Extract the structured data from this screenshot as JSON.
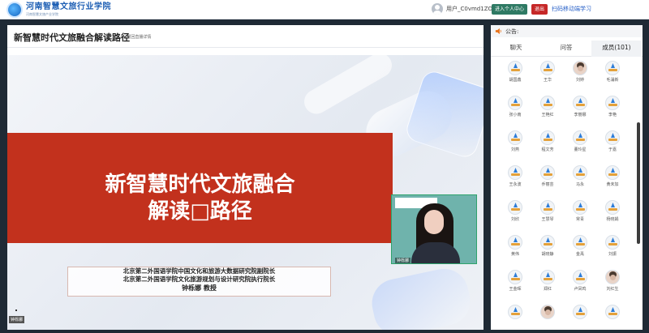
{
  "header": {
    "logo_title": "河南智慧文旅行业学院",
    "logo_subtitle": "河南智慧文旅产业学院",
    "user_name": "用户_C0vmd1ZO",
    "personal_center": "进入个人中心",
    "exit": "退出",
    "scan_link": "扫码移动端学习"
  },
  "stage": {
    "title": "新智慧时代文旅融合解读路径",
    "back_link": "<<返回直播详情",
    "slide_line1": "新智慧时代文旅融合",
    "slide_line2": "解读□路径",
    "author_line1": "北京第二外国语学院中国文化和旅游大数据研究院副院长",
    "author_line2": "北京第二外国语学院文化旅游规划与设计研究院执行院长",
    "author_name": "钟栎娜 教授",
    "live_tag": "钟栎娜",
    "webcam_label": "钟栎娜"
  },
  "panel": {
    "announce_label": "公告:",
    "tabs": [
      "聊天",
      "问答",
      "成员(101)"
    ],
    "members": [
      "胡国鑫",
      "王华",
      "刘婷",
      "毛涌新",
      "张小南",
      "王艳红",
      "李丽娜",
      "李艳",
      "刘燕",
      "程文芳",
      "董玲星",
      "于嘉",
      "王永波",
      "乔丽芸",
      "马永",
      "黄未加",
      "刘欣",
      "王慧琴",
      "常青",
      "杨晓娟",
      "黄伟",
      "胡晓静",
      "金禹",
      "刘振",
      "王金晖",
      "郑红",
      "卢凤鸣",
      "刘红生",
      "",
      "",
      "",
      ""
    ]
  },
  "colors": {
    "accent_red": "#c2311d",
    "button_green": "#2f7a64",
    "button_red": "#c62828",
    "link_blue": "#2b63c9"
  }
}
